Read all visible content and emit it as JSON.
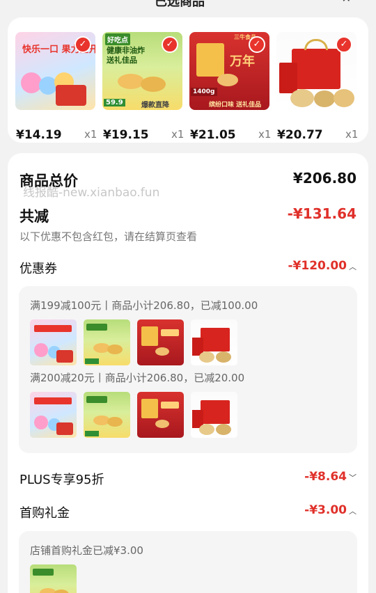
{
  "header": {
    "title": "已选商品",
    "close_icon": "close-icon"
  },
  "products": [
    {
      "price": "¥14.19",
      "qty": "x1",
      "art": "candy",
      "banner": "快乐一口 果力全开",
      "selected": true
    },
    {
      "price": "¥19.15",
      "qty": "x1",
      "art": "cake",
      "banner": "健康非油炸 送礼佳品",
      "brand": "好吃点",
      "tag": "爆款直降",
      "mini_price": "59.9",
      "selected": true
    },
    {
      "price": "¥21.05",
      "qty": "x1",
      "art": "redbox",
      "banner": "万年",
      "sub": "缤纷口味 送礼佳品",
      "brand": "三牛食品",
      "weight": "1400g",
      "selected": true
    },
    {
      "price": "¥20.77",
      "qty": "x1",
      "art": "gift",
      "selected": true
    }
  ],
  "summary": {
    "total_label": "商品总价",
    "total_value": "¥206.80",
    "discount_label": "共减",
    "discount_value": "-¥131.64",
    "discount_note": "以下优惠不包含红包，请在结算页查看",
    "watermark": "线报酷-new.xianbao.fun"
  },
  "coupon": {
    "label": "优惠券",
    "value": "-¥120.00",
    "rules": [
      {
        "text": "满199减100元丨商品小计206.80，已减100.00"
      },
      {
        "text": "满200减20元丨商品小计206.80，已减20.00"
      }
    ]
  },
  "plus": {
    "label": "PLUS专享95折",
    "value": "-¥8.64"
  },
  "first_buy": {
    "label": "首购礼金",
    "value": "-¥3.00",
    "detail": "店铺首购礼金已减¥3.00"
  },
  "colors": {
    "accent": "#e0302a",
    "page_bg": "#f2f2f2"
  }
}
